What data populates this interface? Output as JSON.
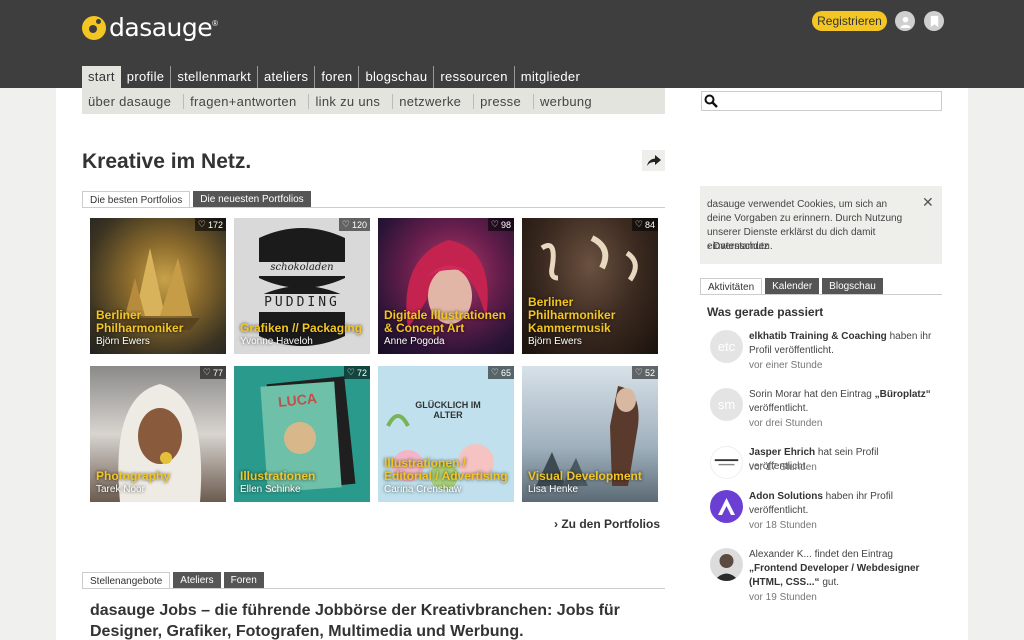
{
  "brand": {
    "name": "dasauge",
    "mark": "®"
  },
  "header": {
    "register_label": "Registrieren"
  },
  "nav_main": [
    "start",
    "profile",
    "stellenmarkt",
    "ateliers",
    "foren",
    "blogschau",
    "ressourcen",
    "mitglieder"
  ],
  "nav_sub": [
    "über dasauge",
    "fragen+antworten",
    "link zu uns",
    "netzwerke",
    "presse",
    "werbung"
  ],
  "search": {
    "placeholder": ""
  },
  "main": {
    "title": "Kreative im Netz.",
    "portfolio_tabs": [
      "Die besten Portfolios",
      "Die neuesten Portfolios"
    ],
    "tiles": [
      {
        "title": "Berliner Philharmoniker",
        "author": "Björn Ewers",
        "likes": "172"
      },
      {
        "title": "Grafiken // Packaging",
        "author": "Yvonne Haveloh",
        "likes": "120"
      },
      {
        "title": "Digitale Illustrationen & Concept Art",
        "author": "Anne Pogoda",
        "likes": "98"
      },
      {
        "title": "Berliner Philharmoniker Kammermusik",
        "author": "Björn Ewers",
        "likes": "84"
      },
      {
        "title": "Photography",
        "author": "Tarek Noor",
        "likes": "77"
      },
      {
        "title": "Illustrationen",
        "author": "Ellen Schinke",
        "likes": "72"
      },
      {
        "title": "Illustrationen / Editorial / Advertising",
        "author": "Carina Crenshaw",
        "likes": "65"
      },
      {
        "title": "Visual Development",
        "author": "Lisa Henke",
        "likes": "52"
      }
    ],
    "tile_texts": {
      "t2": "schokoladen",
      "t2b": "PUDDING",
      "t7": "GLÜCKLICH IM ALTER",
      "t6": "LUCA"
    },
    "more_link": "Zu den Portfolios",
    "bottom_tabs": [
      "Stellenangebote",
      "Ateliers",
      "Foren"
    ],
    "jobs_title": "dasauge Jobs – die führende Jobbörse der Kreativbranchen: Jobs für Designer, Grafiker, Fotografen, Multimedia und Werbung."
  },
  "cookie": {
    "text": "dasauge verwendet Cookies, um sich an deine Vorgaben zu erinnern. Durch Nutzung unserer Dienste erklärst du dich damit einverstanden.",
    "link": "Datenschutz"
  },
  "sidebar": {
    "tabs": [
      "Aktivitäten",
      "Kalender",
      "Blogschau"
    ],
    "heading": "Was gerade passiert",
    "activities": [
      {
        "avatar": "etc",
        "name": "elkhatib Training & Coaching",
        "pre": "",
        "mid": " haben ihr Profil veröffentlicht.",
        "post": "",
        "time": "vor einer Stunde"
      },
      {
        "avatar": "sm",
        "name": "",
        "pre": "Sorin Morar hat den Eintrag ",
        "mid": "„Büroplatz“",
        "post": " veröffentlicht.",
        "time": "vor drei Stunden"
      },
      {
        "avatar": "jasper",
        "name": "Jasper Ehrich",
        "pre": "",
        "mid": " hat sein Profil veröffentlicht.",
        "post": "",
        "time": "vor 17 Stunden"
      },
      {
        "avatar": "adon",
        "name": "Adon Solutions",
        "pre": "",
        "mid": " haben ihr Profil veröffentlicht.",
        "post": "",
        "time": "vor 18 Stunden"
      },
      {
        "avatar": "alex",
        "name": "",
        "pre": "Alexander K... findet den Eintrag ",
        "mid": "„Frontend Developer / Webdesigner (HTML, CSS...“",
        "post": " gut.",
        "time": "vor 19 Stunden"
      }
    ]
  },
  "colors": {
    "accent": "#f3c623",
    "header_bg": "#3e3e3e",
    "adon": "#6b3fd4"
  }
}
